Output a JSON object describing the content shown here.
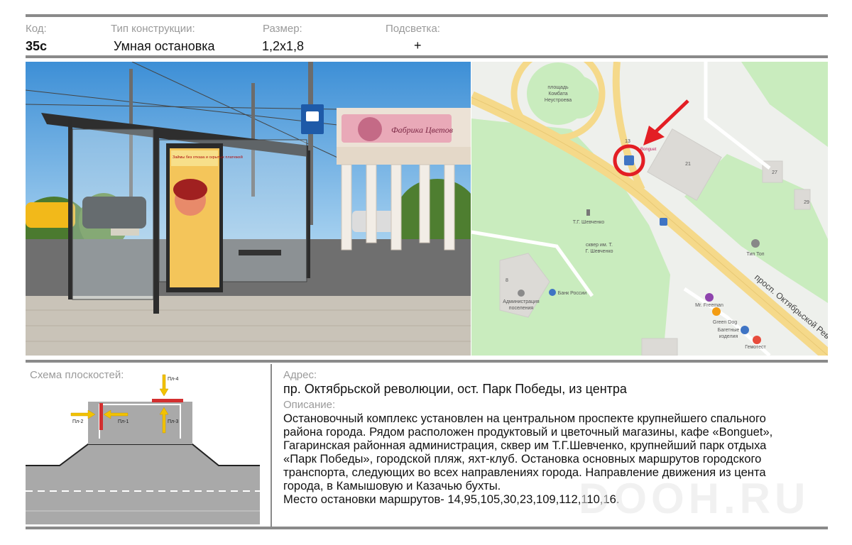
{
  "header": {
    "code_label": "Код:",
    "code_value": "35с",
    "type_label": "Тип конструкции:",
    "type_value": "Умная остановка",
    "size_label": "Размер:",
    "size_value": "1,2х1,8",
    "light_label": "Подсветка:",
    "light_value": "+"
  },
  "photo": {
    "shop_sign": "Фабрика Цветов",
    "poster_headline": "Займы без отказа и скрытых платежей"
  },
  "map": {
    "labels": {
      "square": [
        "площадь",
        "Комбата",
        "Неустроева"
      ],
      "monument": "Т.Г. Шевченко",
      "park": [
        "сквер им. Т.",
        "Г. Шевченко"
      ],
      "admin": [
        "Администрация",
        "поселения"
      ],
      "bank": "Банк России",
      "mrfreeman": "Mr. Freeman",
      "greendog": "Green Dog",
      "bakery": [
        "Багетные",
        "изделия"
      ],
      "gemotest": "Гемотест",
      "tiptop": "Тип Топ",
      "avenue": "просп. Октябрьской Рев",
      "bonguet": "Bonguet",
      "house_13": "13",
      "house_21": "21",
      "house_27": "27",
      "house_29": "29",
      "house_8": "8"
    }
  },
  "schema": {
    "title": "Схема плоскостей:",
    "planes": [
      "Пл-1",
      "Пл-2",
      "Пл-3",
      "Пл-4"
    ]
  },
  "address": {
    "label": "Адрес:",
    "value": "пр. Октябрьской революции, ост. Парк Победы, из центра"
  },
  "description": {
    "label": "Описание:",
    "lines": [
      "Остановочный комплекс установлен на центральном проспекте крупнейшего спального",
      "района города. Рядом  расположен продуктовый и цветочный магазины, кафе «Bonguet»,",
      "Гагаринская районная администрация, сквер им Т.Г.Шевченко, крупнейший парк отдыха",
      "«Парк Победы», городской пляж, яхт-клуб. Остановка основных маршрутов городского",
      "транспорта, следующих во всех направлениях города. Направление движения из цента",
      "города, в  Камышовую и Казачью  бухты.",
      "Место остановки маршрутов- 14,95,105,30,23,109,112,110,16."
    ]
  },
  "watermark": "DOOH.RU",
  "colors": {
    "frame": "#8a8a8a",
    "label": "#9a9a9a",
    "marker": "#e31e24",
    "plane": "#d32f2f",
    "arrow": "#f2c200",
    "road": "#a9a9a9",
    "park": "#c9ecbe",
    "avenue": "#f5d98a"
  }
}
